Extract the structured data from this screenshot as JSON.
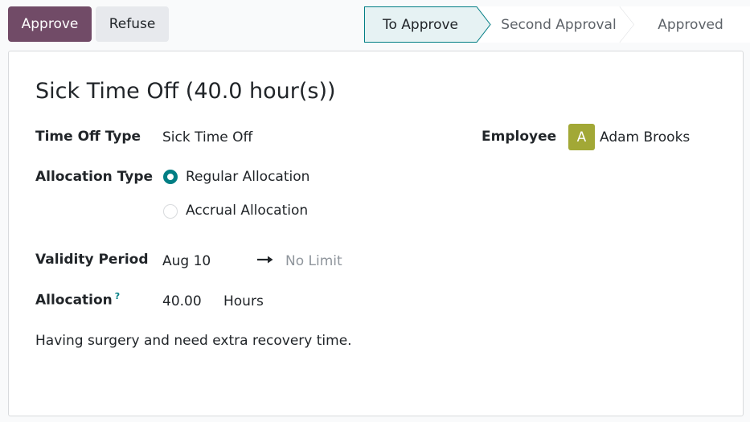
{
  "actions": {
    "approve_label": "Approve",
    "refuse_label": "Refuse"
  },
  "statusbar": {
    "stages": [
      {
        "label": "To Approve",
        "active": true
      },
      {
        "label": "Second Approval",
        "active": false
      },
      {
        "label": "Approved",
        "active": false
      }
    ]
  },
  "form": {
    "title": "Sick Time Off (40.0 hour(s))",
    "time_off_type": {
      "label": "Time Off Type",
      "value": "Sick Time Off"
    },
    "employee": {
      "label": "Employee",
      "avatar_initial": "A",
      "name": "Adam Brooks"
    },
    "allocation_type": {
      "label": "Allocation Type",
      "options": [
        {
          "label": "Regular Allocation",
          "selected": true
        },
        {
          "label": "Accrual Allocation",
          "selected": false
        }
      ]
    },
    "validity": {
      "label": "Validity Period",
      "start": "Aug 10",
      "end": "No Limit"
    },
    "allocation": {
      "label": "Allocation",
      "help": "?",
      "amount": "40.00",
      "unit": "Hours"
    },
    "description": "Having surgery and need extra recovery time."
  },
  "colors": {
    "primary": "#714b67",
    "accent": "#017e84",
    "avatar": "#a2a836"
  }
}
